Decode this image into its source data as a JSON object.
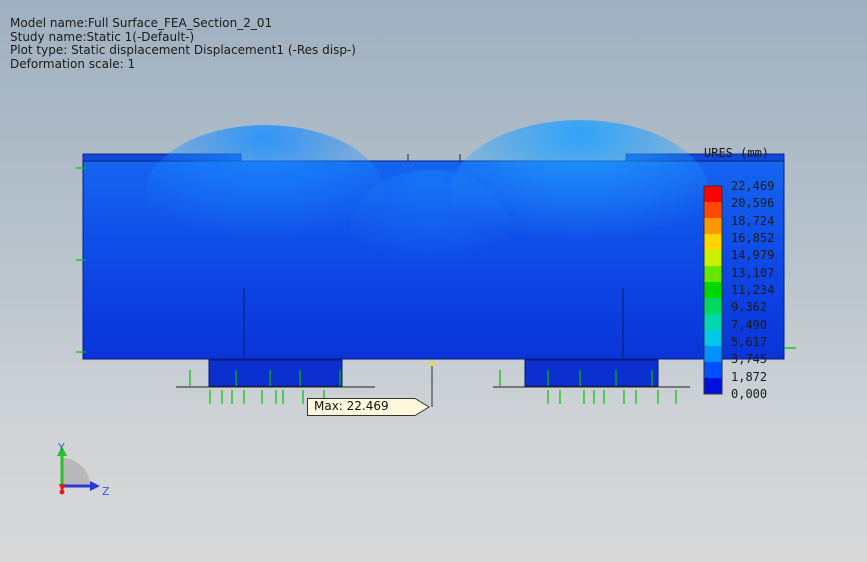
{
  "plot_info": {
    "model_name": "Model name:Full Surface_FEA_Section_2_01",
    "study_name": "Study name:Static 1(-Default-)",
    "plot_type": "Plot type: Static displacement Displacement1 (-Res disp-)",
    "deformation_scale": "Deformation scale: 1"
  },
  "legend": {
    "title": "URES (mm)",
    "values": [
      "22,469",
      "20,596",
      "18,724",
      "16,852",
      "14,979",
      "13,107",
      "11,234",
      "9,362",
      "7,490",
      "5,617",
      "3,745",
      "1,872",
      "0,000"
    ],
    "colors": [
      "#ff0000",
      "#ff4a00",
      "#ff9800",
      "#ffd500",
      "#c8f000",
      "#64e800",
      "#00d800",
      "#00d860",
      "#00d8b0",
      "#00c8e8",
      "#0090ff",
      "#0050ff",
      "#0010e0"
    ]
  },
  "annotation": {
    "max_label": "Max: 22.469"
  },
  "triad": {
    "y_label": "Y",
    "z_label": "Z"
  },
  "colors": {
    "part_blue": "#0d3ae0",
    "part_highlight": "#1780ff",
    "fixture_green": "#00c000"
  }
}
